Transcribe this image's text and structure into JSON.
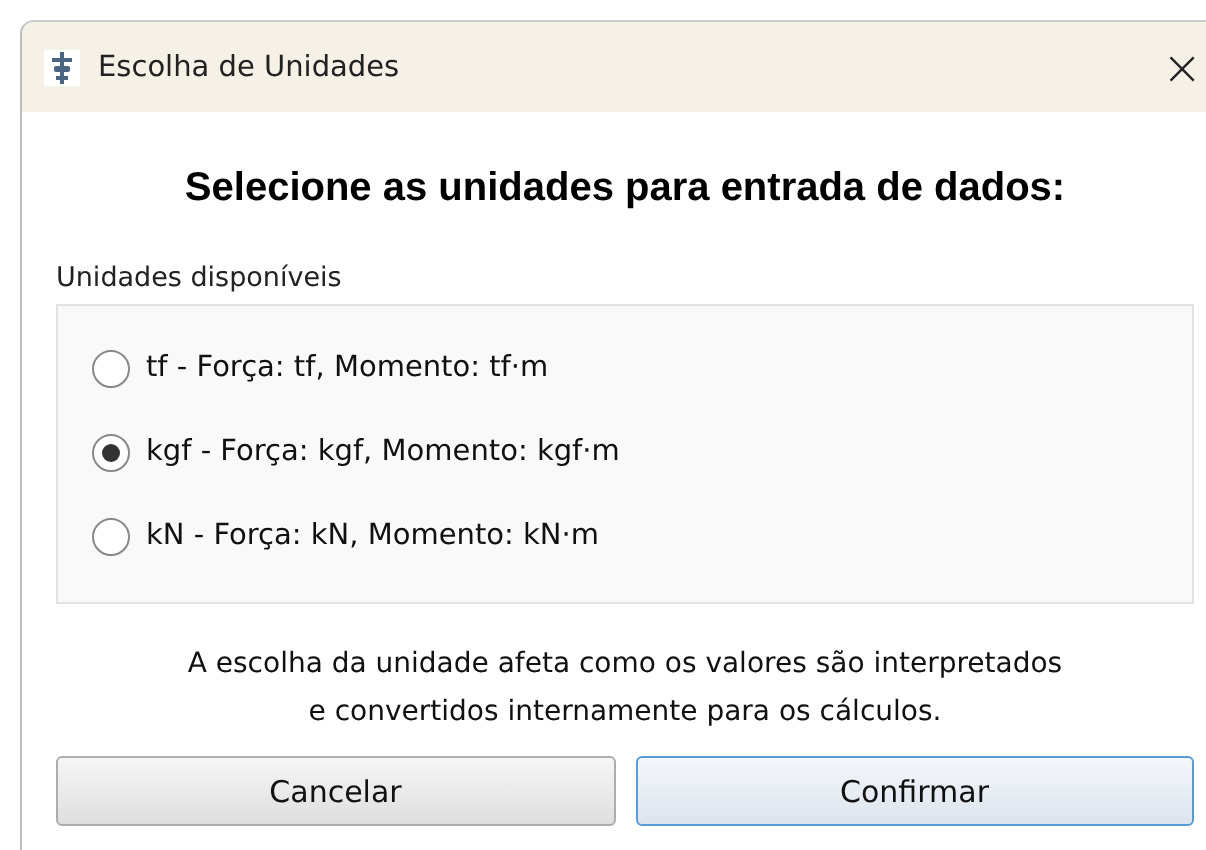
{
  "window": {
    "title": "Escolha de Unidades",
    "close": "×"
  },
  "heading": "Selecione as unidades para entrada de dados:",
  "group": {
    "label": "Unidades disponíveis",
    "options": [
      {
        "label": "tf - Força: tf, Momento: tf·m",
        "selected": false
      },
      {
        "label": "kgf - Força: kgf, Momento: kgf·m",
        "selected": true
      },
      {
        "label": "kN - Força: kN, Momento: kN·m",
        "selected": false
      }
    ]
  },
  "note": [
    "A escolha da unidade afeta como os valores são interpretados",
    "e convertidos internamente para os cálculos."
  ],
  "buttons": [
    {
      "label": "Cancelar",
      "kind": "normal"
    },
    {
      "label": "Confirmar",
      "kind": "default"
    }
  ]
}
